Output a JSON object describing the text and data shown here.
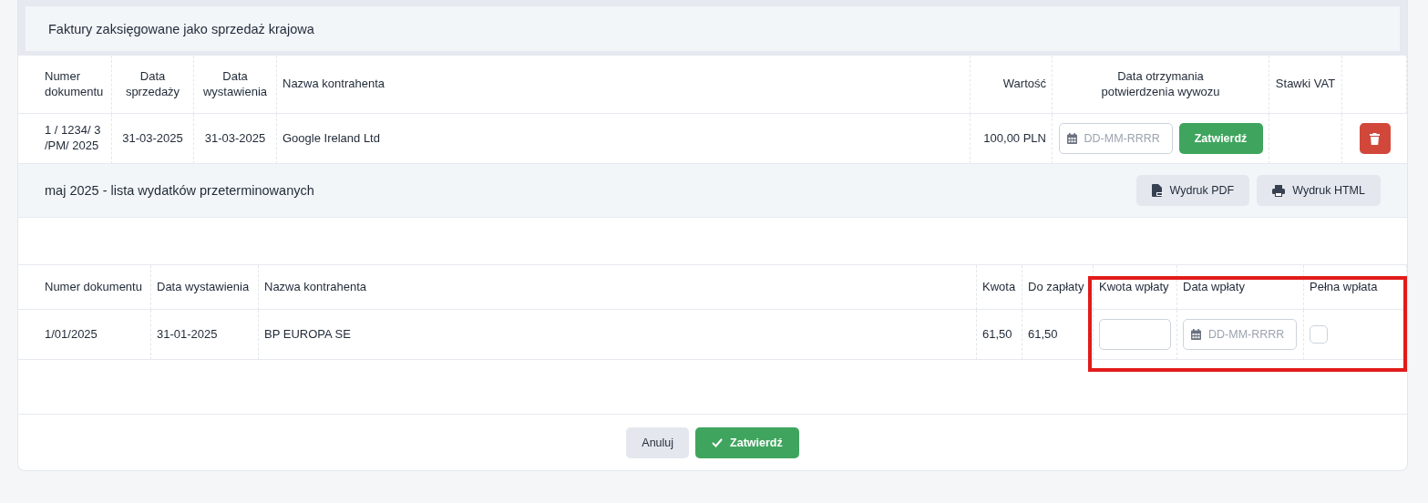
{
  "invoices": {
    "title": "Faktury zaksięgowane jako sprzedaż krajowa",
    "columns": [
      "Numer dokumentu",
      "Data sprzedaży",
      "Data wystawienia",
      "Nazwa kontrahenta",
      "Wartość",
      "Data otrzymania potwierdzenia wywozu",
      "Stawki VAT"
    ],
    "rows": [
      {
        "number": "1 / 1234/ 3 /PM/ 2025",
        "sale_date": "31-03-2025",
        "issue_date": "31-03-2025",
        "contractor": "Google Ireland Ltd",
        "value": "100,00 PLN",
        "date_placeholder": "DD-MM-RRRR",
        "confirm": "Zatwierdź"
      }
    ]
  },
  "expenses": {
    "title": "maj 2025 - lista wydatków przeterminowanych",
    "buttons": [
      {
        "label": "Wydruk PDF",
        "kind": "pdf"
      },
      {
        "label": "Wydruk HTML",
        "kind": "print"
      }
    ],
    "columns": [
      "Numer dokumentu",
      "Data wystawienia",
      "Nazwa kontrahenta",
      "Kwota",
      "Do zapłaty",
      "Kwota wpłaty",
      "Data wpłaty",
      "Pełna wpłata"
    ],
    "rows": [
      {
        "number": "1/01/2025",
        "issue_date": "31-01-2025",
        "contractor": "BP EUROPA SE",
        "amount": "61,50",
        "due": "61,50",
        "date_placeholder": "DD-MM-RRRR",
        "full_payment": false
      }
    ]
  },
  "footer": [
    {
      "label": "Anuluj",
      "kind": "secondary"
    },
    {
      "label": "Zatwierdź",
      "kind": "primary"
    }
  ]
}
